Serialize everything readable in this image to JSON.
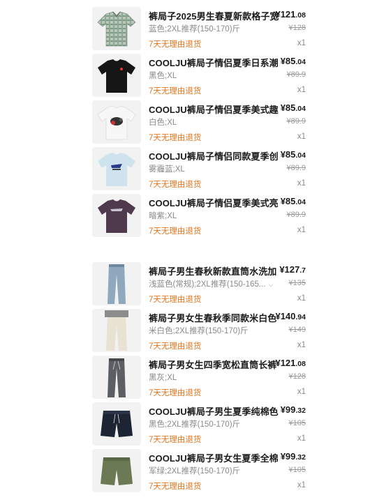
{
  "orders": [
    {
      "items": [
        {
          "thumb": "plaid-shirt",
          "title": "裤局子2025男生春夏新款格子宽",
          "price_int": "¥121",
          "price_dec": ".08",
          "spec": "蓝色;2XL推荐(150-170)斤",
          "orig": "¥128",
          "badge": "7天无理由退货",
          "qty": "x1"
        },
        {
          "thumb": "tee-black",
          "title": "COOLJU裤局子情侣夏季日系潮",
          "price_int": "¥85",
          "price_dec": ".04",
          "spec": "黑色;XL",
          "orig": "¥89.9",
          "badge": "7天无理由退货",
          "qty": "x1"
        },
        {
          "thumb": "tee-white-print",
          "title": "COOLJU裤局子情侣夏季美式趣",
          "price_int": "¥85",
          "price_dec": ".04",
          "spec": "白色;XL",
          "orig": "¥89.9",
          "badge": "7天无理由退货",
          "qty": "x1"
        },
        {
          "thumb": "tee-lightblue",
          "title": "COOLJU裤局子情侣同款夏季创",
          "price_int": "¥85",
          "price_dec": ".04",
          "spec": "雾霾蓝;XL",
          "orig": "¥89.9",
          "badge": "7天无理由退货",
          "qty": "x1"
        },
        {
          "thumb": "tee-purple",
          "title": "COOLJU裤局子情侣夏季美式亮",
          "price_int": "¥85",
          "price_dec": ".04",
          "spec": "暗紫;XL",
          "orig": "¥89.9",
          "badge": "7天无理由退货",
          "qty": "x1"
        }
      ]
    },
    {
      "items": [
        {
          "thumb": "jeans-blue",
          "title": "裤局子男生春秋新款直筒水洗加",
          "price_int": "¥127",
          "price_dec": ".7",
          "spec": "浅蓝色(常规);2XL推荐(150-165...",
          "orig": "¥135",
          "badge": "7天无理由退货",
          "qty": "x1",
          "has_dropdown": true
        },
        {
          "thumb": "pants-cream",
          "title": "裤局子男女生春秋季同款米白色",
          "price_int": "¥140",
          "price_dec": ".94",
          "spec": "米白色;2XL推荐(150-170)斤",
          "orig": "¥149",
          "badge": "7天无理由退货",
          "qty": "x1"
        },
        {
          "thumb": "pants-grey",
          "title": "裤局子男女生四季宽松直筒长裤",
          "price_int": "¥121",
          "price_dec": ".08",
          "spec": "黑灰;XL",
          "orig": "¥128",
          "badge": "7天无理由退货",
          "qty": "x1"
        },
        {
          "thumb": "shorts-navy",
          "title": "COOLJU裤局子男生夏季纯棉色",
          "price_int": "¥99",
          "price_dec": ".32",
          "spec": "黑色;2XL推荐(150-170)斤",
          "orig": "¥105",
          "badge": "7天无理由退货",
          "qty": "x1"
        },
        {
          "thumb": "shorts-green",
          "title": "COOLJU裤局子男女生夏季全棉",
          "price_int": "¥99",
          "price_dec": ".32",
          "spec": "军绿;2XL推荐(150-170)斤",
          "orig": "¥105",
          "badge": "7天无理由退货",
          "qty": "x1"
        }
      ]
    }
  ],
  "colors": {
    "badge": "#e3731a",
    "muted": "#8a8a8a"
  }
}
